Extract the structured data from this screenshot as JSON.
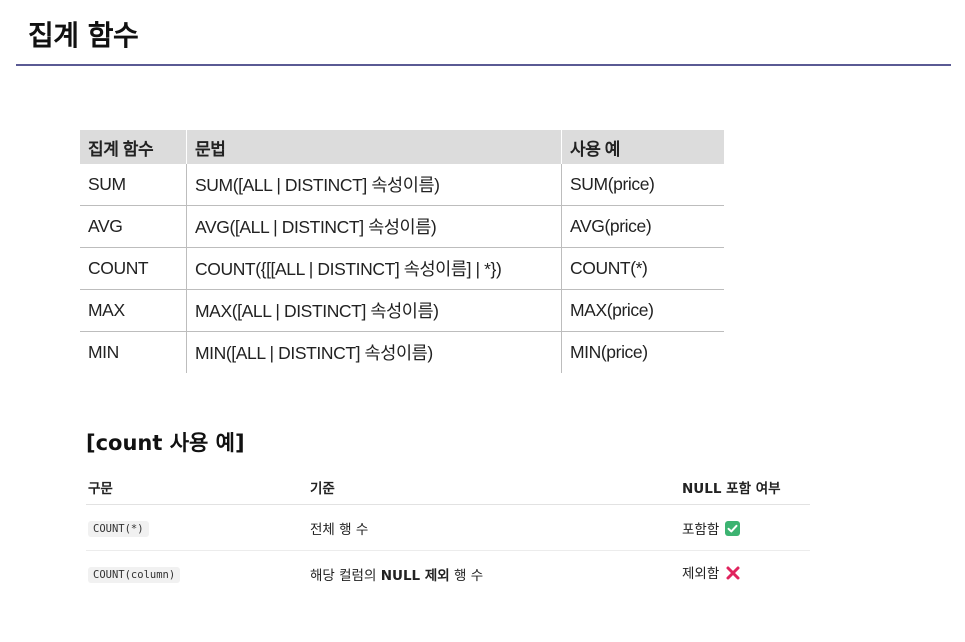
{
  "page": {
    "title": "집계 함수"
  },
  "aggregate_table": {
    "headers": [
      "집계 함수",
      "문법",
      "사용 예"
    ],
    "rows": [
      [
        "SUM",
        "SUM([ALL | DISTINCT] 속성이름)",
        "SUM(price)"
      ],
      [
        "AVG",
        "AVG([ALL | DISTINCT] 속성이름)",
        "AVG(price)"
      ],
      [
        "COUNT",
        "COUNT({[[ALL | DISTINCT] 속성이름] | *})",
        "COUNT(*)"
      ],
      [
        "MAX",
        "MAX([ALL | DISTINCT] 속성이름)",
        "MAX(price)"
      ],
      [
        "MIN",
        "MIN([ALL | DISTINCT] 속성이름)",
        "MIN(price)"
      ]
    ]
  },
  "count_example": {
    "title": "[count 사용 예]",
    "headers": [
      "구문",
      "기준",
      "NULL 포함 여부"
    ],
    "rows": [
      {
        "syntax": "COUNT(*)",
        "criteria_pre": "전체 행 수",
        "criteria_bold": "",
        "criteria_post": "",
        "null_label": "포함함",
        "null_icon": "check-icon"
      },
      {
        "syntax": "COUNT(column)",
        "criteria_pre": "해당 컬럼의 ",
        "criteria_bold": "NULL 제외",
        "criteria_post": " 행 수",
        "null_label": "제외함",
        "null_icon": "cross-icon"
      }
    ]
  },
  "colors": {
    "rule": "#5a5a94",
    "table_header_bg": "#dcdcdc",
    "check_green": "#3cb371",
    "cross_red": "#e0245e"
  }
}
